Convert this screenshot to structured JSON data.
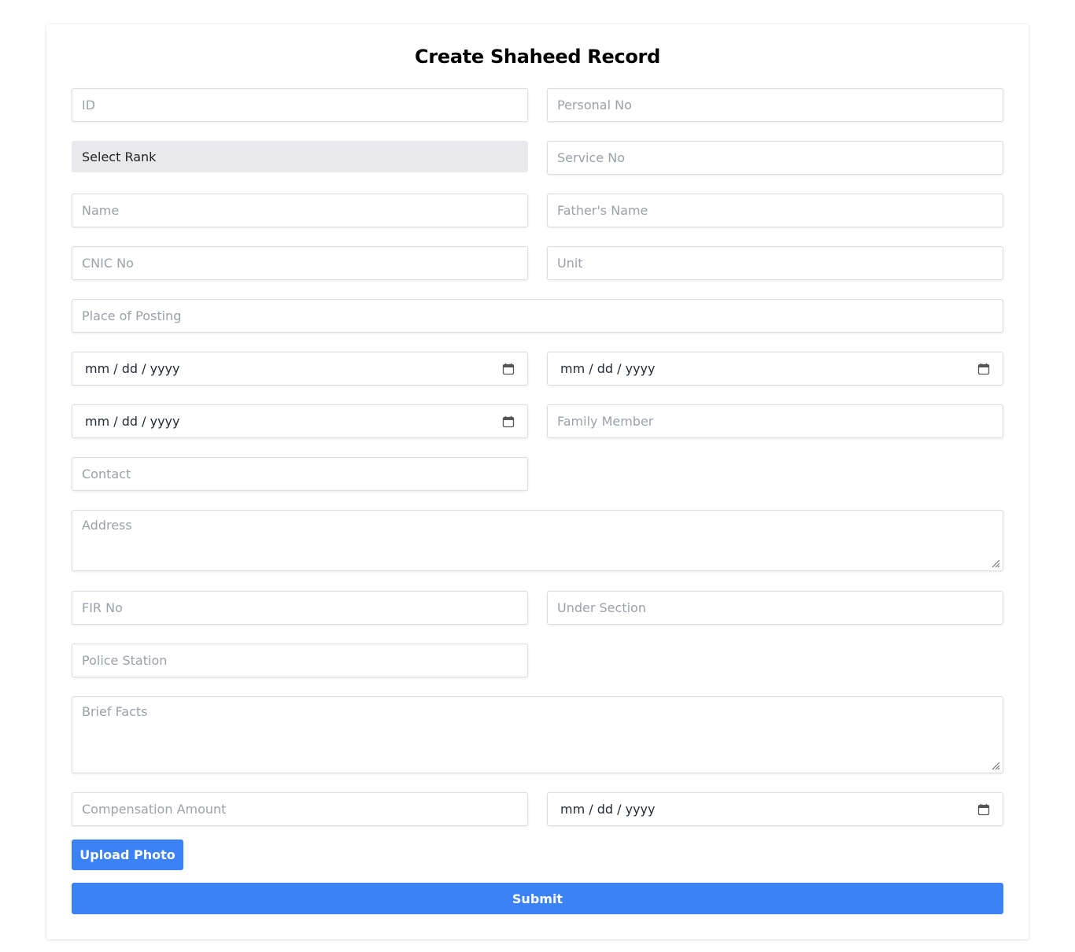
{
  "form": {
    "title": "Create Shaheed Record",
    "placeholders": {
      "id": "ID",
      "personal_no": "Personal No",
      "service_no": "Service No",
      "name": "Name",
      "fathers_name": "Father's Name",
      "cnic_no": "CNIC No",
      "unit": "Unit",
      "place_of_posting": "Place of Posting",
      "family_member": "Family Member",
      "contact": "Contact",
      "address": "Address",
      "fir_no": "FIR No",
      "under_section": "Under Section",
      "police_station": "Police Station",
      "brief_facts": "Brief Facts",
      "compensation_amount": "Compensation Amount"
    },
    "rank_select": {
      "selected": "Select Rank"
    },
    "date_format": "mm / dd / yyyy",
    "buttons": {
      "upload_photo": "Upload Photo",
      "submit": "Submit"
    }
  },
  "icons": {
    "date_picker": "calendar-icon",
    "textarea_resize": "resize-grip-icon"
  },
  "colors": {
    "primary": "#3b82f6",
    "select_bg": "#e8e8ed"
  }
}
